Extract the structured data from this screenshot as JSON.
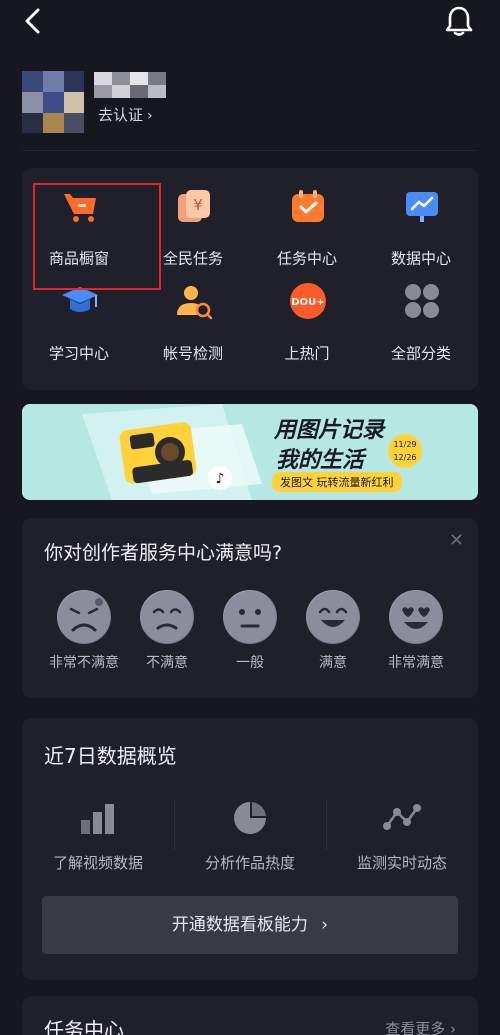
{
  "profile": {
    "verify_label": "去认证"
  },
  "tools": [
    {
      "label": "商品橱窗",
      "icon": "shopping-cart-icon"
    },
    {
      "label": "全民任务",
      "icon": "yuan-coin-icon"
    },
    {
      "label": "任务中心",
      "icon": "calendar-check-icon"
    },
    {
      "label": "数据中心",
      "icon": "chart-board-icon"
    },
    {
      "label": "学习中心",
      "icon": "graduation-cap-icon"
    },
    {
      "label": "帐号检测",
      "icon": "user-search-icon"
    },
    {
      "label": "上热门",
      "icon": "dou-plus-icon"
    },
    {
      "label": "全部分类",
      "icon": "grid-dots-icon"
    }
  ],
  "banner": {
    "headline1": "用图片记录",
    "headline2": "我的生活",
    "sub": "发图文 玩转流量新红利",
    "date_from": "11/29",
    "date_to": "12/26"
  },
  "survey": {
    "title": "你对创作者服务中心满意吗?",
    "options": [
      "非常不满意",
      "不满意",
      "一般",
      "满意",
      "非常满意"
    ]
  },
  "stats": {
    "title": "近7日数据概览",
    "items": [
      {
        "label": "了解视频数据",
        "icon": "bar-chart-icon"
      },
      {
        "label": "分析作品热度",
        "icon": "pie-chart-icon"
      },
      {
        "label": "监测实时动态",
        "icon": "line-trend-icon"
      }
    ],
    "open_label": "开通数据看板能力"
  },
  "task_center": {
    "title": "任务中心",
    "more": "查看更多"
  },
  "colors": {
    "background": "#17171f",
    "card": "#20202a",
    "accent_orange": "#ff6a2b",
    "highlight": "#e3242b"
  }
}
